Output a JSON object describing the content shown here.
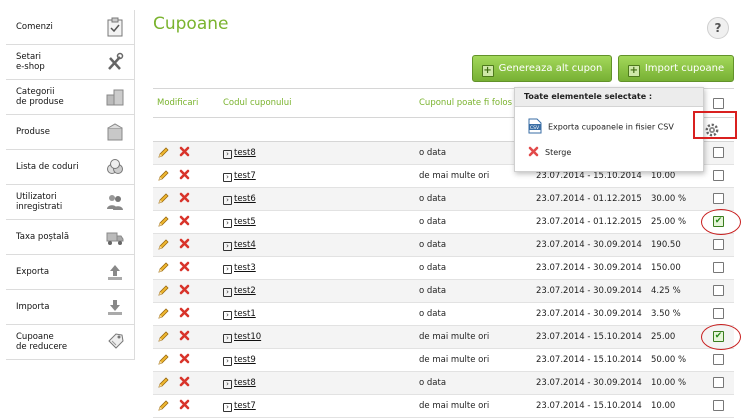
{
  "sidebar": {
    "items": [
      {
        "label": "Comenzi",
        "icon": "clipboard-icon"
      },
      {
        "label": "Setari\ne-shop",
        "icon": "tools-icon"
      },
      {
        "label": "Categorii\nde produse",
        "icon": "boxes-icon"
      },
      {
        "label": "Produse",
        "icon": "box-icon"
      },
      {
        "label": "Lista de coduri",
        "icon": "coins-icon"
      },
      {
        "label": "Utilizatori\ninregistrati",
        "icon": "users-icon"
      },
      {
        "label": "Taxa poștală",
        "icon": "cart-icon"
      },
      {
        "label": "Exporta",
        "icon": "upload-icon"
      },
      {
        "label": "Importa",
        "icon": "download-icon"
      },
      {
        "label": "Cupoane\nde reducere",
        "icon": "coupon-tag-icon"
      }
    ]
  },
  "page": {
    "title": "Cupoane",
    "help": "?"
  },
  "toolbar": {
    "generate_label": "Genereaza alt cupon",
    "import_label": "Import cupoane",
    "plus": "+"
  },
  "table": {
    "headers": {
      "edit": "Modificari",
      "name": "Codul cuponului",
      "usage": "Cuponul poate fi folos"
    },
    "rows": [
      {
        "name": "test8",
        "usage": "o data",
        "period": "",
        "value": "",
        "checked": false
      },
      {
        "name": "test7",
        "usage": "de mai multe ori",
        "period": "23.07.2014 - 15.10.2014",
        "value": "10.00",
        "checked": false
      },
      {
        "name": "test6",
        "usage": "o data",
        "period": "23.07.2014 - 01.12.2015",
        "value": "30.00 %",
        "checked": false
      },
      {
        "name": "test5",
        "usage": "o data",
        "period": "23.07.2014 - 01.12.2015",
        "value": "25.00 %",
        "checked": true
      },
      {
        "name": "test4",
        "usage": "o data",
        "period": "23.07.2014 - 30.09.2014",
        "value": "190.50",
        "checked": false
      },
      {
        "name": "test3",
        "usage": "o data",
        "period": "23.07.2014 - 30.09.2014",
        "value": "150.00",
        "checked": false
      },
      {
        "name": "test2",
        "usage": "o data",
        "period": "23.07.2014 - 30.09.2014",
        "value": "4.25 %",
        "checked": false
      },
      {
        "name": "test1",
        "usage": "o data",
        "period": "23.07.2014 - 30.09.2014",
        "value": "3.50 %",
        "checked": false
      },
      {
        "name": "test10",
        "usage": "de mai multe ori",
        "period": "23.07.2014 - 15.10.2014",
        "value": "25.00",
        "checked": true
      },
      {
        "name": "test9",
        "usage": "de mai multe ori",
        "period": "23.07.2014 - 15.10.2014",
        "value": "50.00 %",
        "checked": false
      },
      {
        "name": "test8",
        "usage": "o data",
        "period": "23.07.2014 - 30.09.2014",
        "value": "10.00 %",
        "checked": false
      },
      {
        "name": "test7",
        "usage": "de mai multe ori",
        "period": "23.07.2014 - 15.10.2014",
        "value": "10.00",
        "checked": false
      }
    ]
  },
  "popup": {
    "title": "Toate elementele selectate :",
    "export_label": "Exporta cupoanele in fisier CSV",
    "delete_label": "Sterge",
    "csv_icon_text": "CSV"
  },
  "colors": {
    "accent": "#7ab32e",
    "button": "#8cc346",
    "annotation": "#d9201f"
  }
}
